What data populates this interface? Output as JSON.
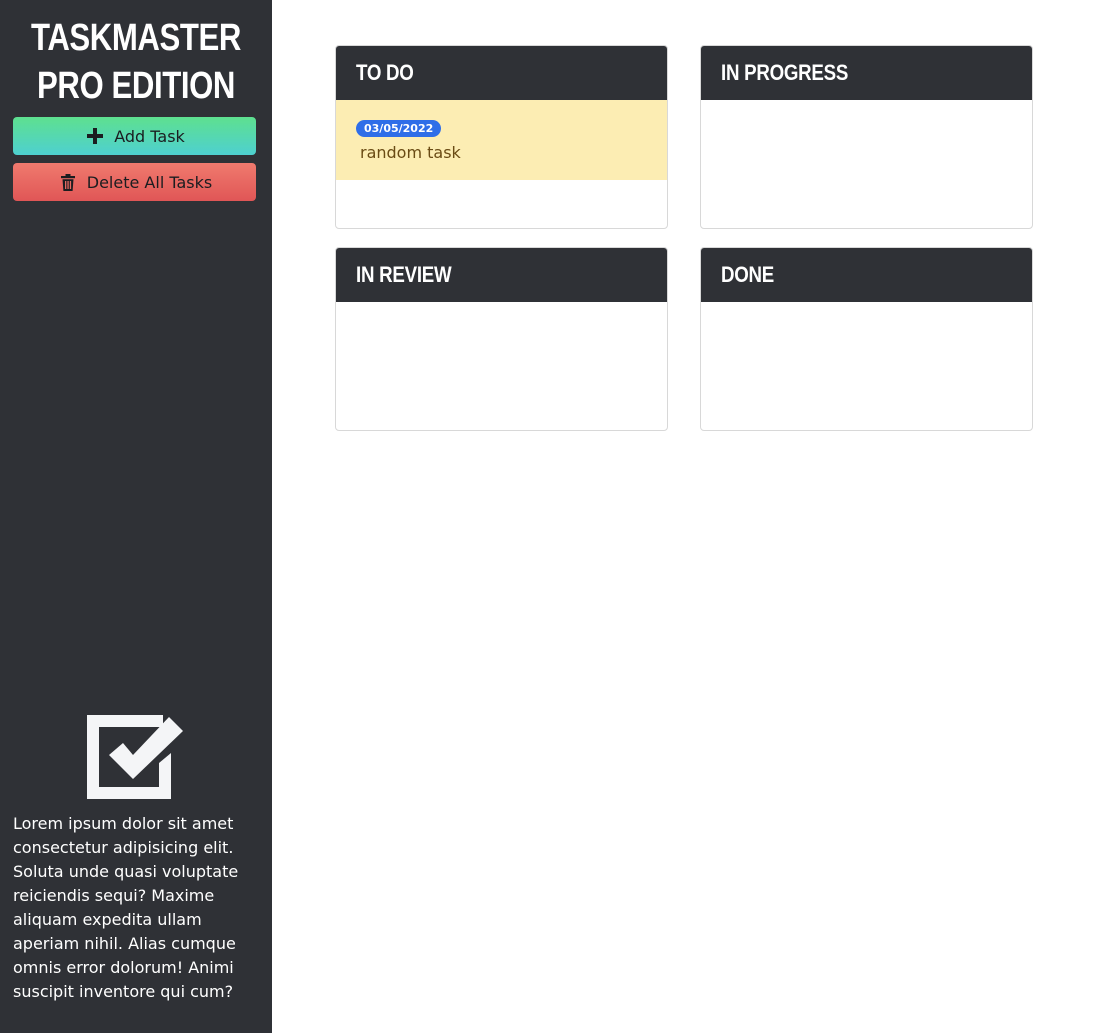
{
  "app": {
    "title": "TASKMASTER PRO EDITION"
  },
  "sidebar": {
    "add_button": {
      "label": "Add Task",
      "icon": "plus-icon"
    },
    "delete_button": {
      "label": "Delete All Tasks",
      "icon": "trash-icon"
    },
    "logo_icon": "checkbox-checked-icon",
    "description": "Lorem ipsum dolor sit amet consectetur adipisicing elit. Soluta unde quasi voluptate reiciendis sequi? Maxime aliquam expedita ullam aperiam nihil. Alias cumque omnis error dolorum! Animi suscipit inventore qui cum?"
  },
  "board": {
    "columns": [
      {
        "title": "TO DO",
        "tasks": [
          {
            "date": "03/05/2022",
            "text": "random task"
          }
        ]
      },
      {
        "title": "IN PROGRESS",
        "tasks": []
      },
      {
        "title": "IN REVIEW",
        "tasks": []
      },
      {
        "title": "DONE",
        "tasks": []
      }
    ]
  },
  "colors": {
    "sidebar_bg": "#2f3136",
    "add_button_gradient": [
      "#5ee08f",
      "#4ed0d0"
    ],
    "delete_button_gradient": [
      "#f07a6e",
      "#e05656"
    ],
    "task_bg": "#fcedb3",
    "badge_bg": "#2f6ee8"
  }
}
